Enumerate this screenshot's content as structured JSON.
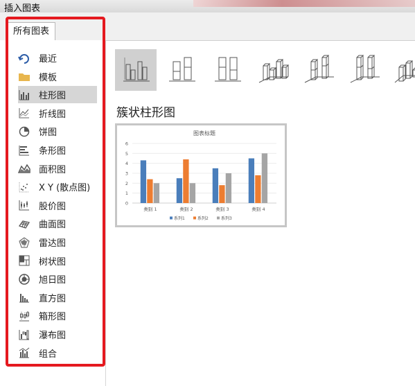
{
  "window": {
    "title": "插入图表"
  },
  "tabs": [
    {
      "label": "所有图表"
    }
  ],
  "sidebar": {
    "items": [
      {
        "label": "最近",
        "icon": "recent-icon"
      },
      {
        "label": "模板",
        "icon": "folder-icon"
      },
      {
        "label": "柱形图",
        "icon": "column-chart-icon",
        "selected": true
      },
      {
        "label": "折线图",
        "icon": "line-chart-icon"
      },
      {
        "label": "饼图",
        "icon": "pie-chart-icon"
      },
      {
        "label": "条形图",
        "icon": "bar-chart-icon"
      },
      {
        "label": "面积图",
        "icon": "area-chart-icon"
      },
      {
        "label": "X Y (散点图)",
        "icon": "scatter-chart-icon"
      },
      {
        "label": "股价图",
        "icon": "stock-chart-icon"
      },
      {
        "label": "曲面图",
        "icon": "surface-chart-icon"
      },
      {
        "label": "雷达图",
        "icon": "radar-chart-icon"
      },
      {
        "label": "树状图",
        "icon": "treemap-chart-icon"
      },
      {
        "label": "旭日图",
        "icon": "sunburst-chart-icon"
      },
      {
        "label": "直方图",
        "icon": "histogram-chart-icon"
      },
      {
        "label": "箱形图",
        "icon": "box-whisker-chart-icon"
      },
      {
        "label": "瀑布图",
        "icon": "waterfall-chart-icon"
      },
      {
        "label": "组合",
        "icon": "combo-chart-icon"
      }
    ]
  },
  "main": {
    "variants": [
      {
        "icon": "clustered-column-icon",
        "selected": true
      },
      {
        "icon": "stacked-column-icon"
      },
      {
        "icon": "100-stacked-column-icon"
      },
      {
        "icon": "3d-clustered-column-icon"
      },
      {
        "icon": "3d-stacked-column-icon"
      },
      {
        "icon": "3d-100-stacked-column-icon"
      },
      {
        "icon": "3d-column-icon"
      }
    ],
    "heading": "簇状柱形图"
  },
  "colors": {
    "highlight_frame": "#e5191f",
    "series1": "#4a7ebb",
    "series2": "#ed7d31",
    "series3": "#a5a5a5"
  },
  "chart_data": {
    "type": "bar",
    "title": "图表标题",
    "categories": [
      "类别 1",
      "类别 2",
      "类别 3",
      "类别 4"
    ],
    "series": [
      {
        "name": "系列1",
        "values": [
          4.3,
          2.5,
          3.5,
          4.5
        ]
      },
      {
        "name": "系列2",
        "values": [
          2.4,
          4.4,
          1.8,
          2.8
        ]
      },
      {
        "name": "系列3",
        "values": [
          2,
          2,
          3,
          5
        ]
      }
    ],
    "yticks": [
      0,
      1,
      2,
      3,
      4,
      5,
      6
    ],
    "ylim": [
      0,
      6
    ],
    "grid": true,
    "legend": "bottom"
  }
}
